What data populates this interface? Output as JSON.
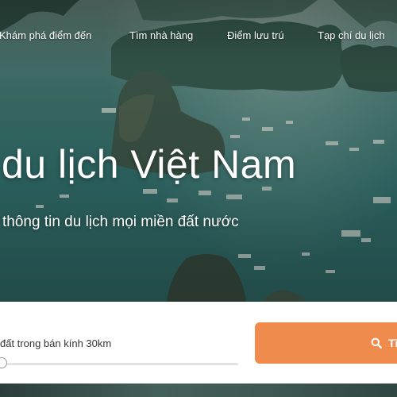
{
  "nav": {
    "items": [
      {
        "label": "Khám phá điểm đến"
      },
      {
        "label": "Tìm nhà hàng"
      },
      {
        "label": "Điểm lưu trú"
      },
      {
        "label": "Tạp chí du lịch"
      }
    ]
  },
  "hero": {
    "title": "du lịch Việt Nam",
    "subtitle": "thông tin du lịch mọi miền đất nước"
  },
  "search": {
    "radius_label": "đất trong bán kính 30km",
    "radius_km": 0,
    "button_label": "Tì",
    "button_icon": "search-icon",
    "accent_color": "#ef8b4d"
  }
}
